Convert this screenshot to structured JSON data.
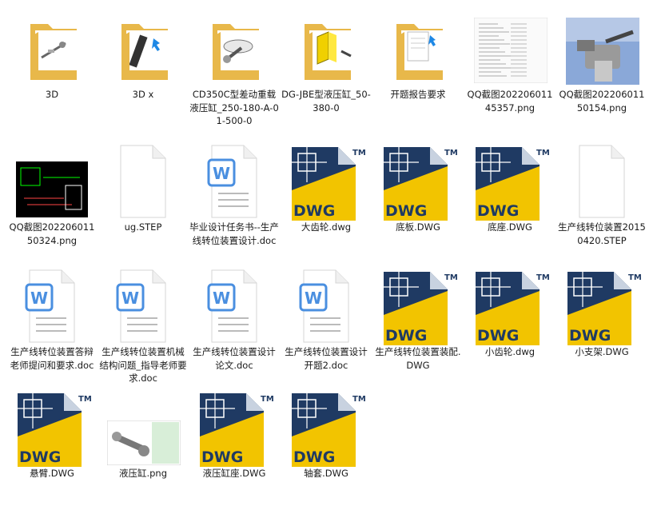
{
  "files": [
    {
      "name": "3D",
      "type": "folder",
      "preview": "tube"
    },
    {
      "name": "3D x",
      "type": "folder",
      "preview": "rod"
    },
    {
      "name": "CD350C型差动重载液压缸_250-180-A-01-500-0",
      "type": "folder",
      "preview": "rod2"
    },
    {
      "name": "DG-JBE型液压缸_50-380-0",
      "type": "folder",
      "preview": "yellowblock"
    },
    {
      "name": "开题报告要求",
      "type": "folder",
      "preview": "doc"
    },
    {
      "name": "QQ截图20220601145357.png",
      "type": "image",
      "preview": "table"
    },
    {
      "name": "QQ截图20220601150154.png",
      "type": "image",
      "preview": "machine"
    },
    {
      "name": "QQ截图20220601150324.png",
      "type": "image",
      "preview": "cad"
    },
    {
      "name": "ug.STEP",
      "type": "blank"
    },
    {
      "name": "毕业设计任务书--生产线转位装置设计.doc",
      "type": "word"
    },
    {
      "name": "大齿轮.dwg",
      "type": "dwg"
    },
    {
      "name": "底板.DWG",
      "type": "dwg"
    },
    {
      "name": "底座.DWG",
      "type": "dwg"
    },
    {
      "name": "生产线转位装置20150420.STEP",
      "type": "blank"
    },
    {
      "name": "生产线转位装置答辩老师提问和要求.doc",
      "type": "word"
    },
    {
      "name": "生产线转位装置机械结构问题_指导老师要求.doc",
      "type": "word"
    },
    {
      "name": "生产线转位装置设计  论文.doc",
      "type": "word"
    },
    {
      "name": "生产线转位装置设计开题2.doc",
      "type": "word"
    },
    {
      "name": "生产线转位装置装配.DWG",
      "type": "dwg"
    },
    {
      "name": "小齿轮.dwg",
      "type": "dwg"
    },
    {
      "name": "小支架.DWG",
      "type": "dwg"
    },
    {
      "name": "悬臂.DWG",
      "type": "dwg"
    },
    {
      "name": "液压缸.png",
      "type": "image",
      "preview": "cylinder"
    },
    {
      "name": "液压缸座.DWG",
      "type": "dwg"
    },
    {
      "name": "轴套.DWG",
      "type": "dwg"
    }
  ],
  "icon_text": {
    "dwg": "DWG",
    "tm": "TM",
    "word": "W"
  },
  "colors": {
    "folder_back": "#e8b84a",
    "folder_front": "#f7d679",
    "dwg_navy": "#1f3a63",
    "dwg_yellow": "#f2c400",
    "word_blue": "#4a8fe0",
    "page_border": "#d6d6d6"
  }
}
